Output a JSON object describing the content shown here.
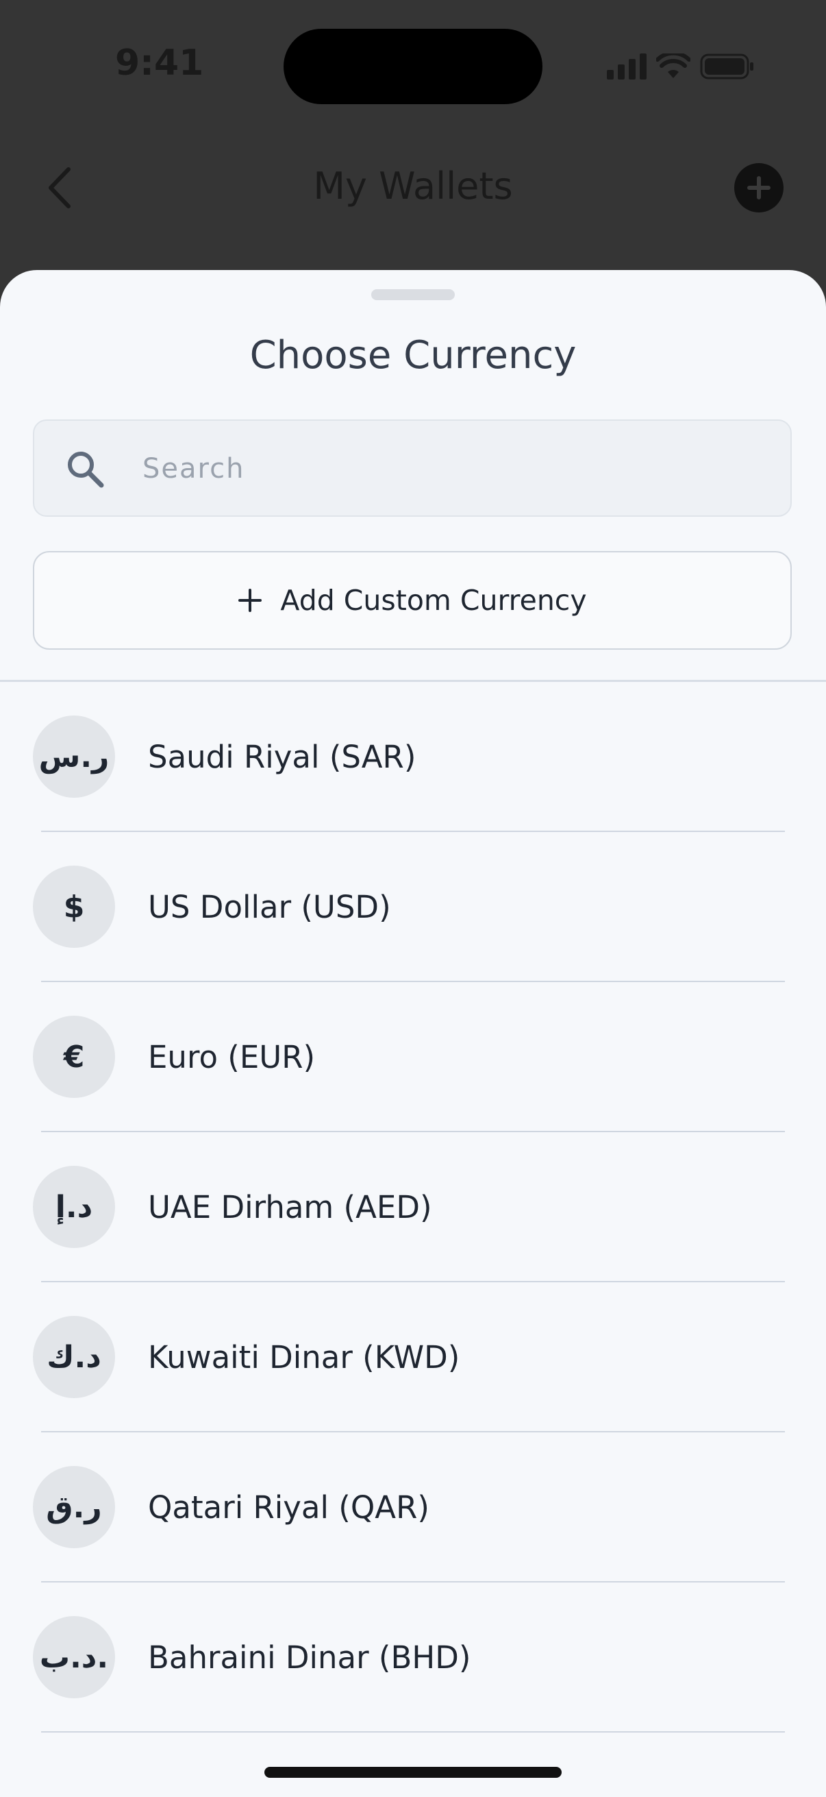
{
  "status_bar": {
    "time": "9:41"
  },
  "header": {
    "title": "My Wallets"
  },
  "sheet": {
    "title": "Choose Currency",
    "search": {
      "placeholder": "Search",
      "value": ""
    },
    "add_custom_label": "Add Custom Currency"
  },
  "currencies": [
    {
      "symbol": "ر.س",
      "name": "Saudi Riyal (SAR)"
    },
    {
      "symbol": "$",
      "name": "US Dollar (USD)"
    },
    {
      "symbol": "€",
      "name": "Euro (EUR)"
    },
    {
      "symbol": "د.إ",
      "name": "UAE Dirham (AED)"
    },
    {
      "symbol": "د.ك",
      "name": "Kuwaiti Dinar (KWD)"
    },
    {
      "symbol": "ر.ق",
      "name": "Qatari Riyal (QAR)"
    },
    {
      "symbol": "د.ب.",
      "name": "Bahraini Dinar (BHD)"
    }
  ],
  "icons": {
    "back": "chevron-left-icon",
    "add_wallet": "plus-circle-icon",
    "search": "search-icon",
    "add_custom": "plus-icon"
  },
  "colors": {
    "overlay": "#353535",
    "sheet_background": "#f6f8fb",
    "title_text": "#343c4a",
    "body_text": "#1e2530",
    "placeholder": "#9aa2ad"
  }
}
